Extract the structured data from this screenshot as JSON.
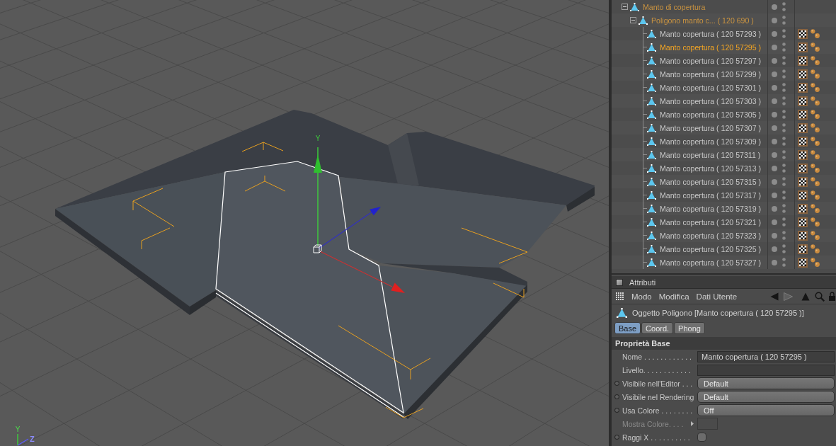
{
  "viewport": {
    "move_gizmo": {
      "y_label": "Y"
    },
    "axis_indicator": {
      "y_label": "Y",
      "z_label": "Z"
    }
  },
  "object_manager": {
    "objects": [
      {
        "name": "Manto di copertura",
        "expanded": true,
        "selected": false,
        "children": [
          {
            "name": "Poligono manto c... ( 120 690 )",
            "expanded": true,
            "selected": false,
            "children": [
              {
                "name": "Manto copertura ( 120 57293 )",
                "selected": false,
                "tags": [
                  {
                    "kind": "texture"
                  },
                  {
                    "kind": "phong"
                  }
                ]
              },
              {
                "name": "Manto copertura ( 120 57295 )",
                "selected": true,
                "tags": [
                  {
                    "kind": "texture"
                  },
                  {
                    "kind": "phong"
                  }
                ]
              },
              {
                "name": "Manto copertura ( 120 57297 )",
                "selected": false,
                "tags": [
                  {
                    "kind": "texture"
                  },
                  {
                    "kind": "phong"
                  }
                ]
              },
              {
                "name": "Manto copertura ( 120 57299 )",
                "selected": false,
                "tags": [
                  {
                    "kind": "texture"
                  },
                  {
                    "kind": "phong"
                  }
                ]
              },
              {
                "name": "Manto copertura ( 120 57301 )",
                "selected": false,
                "tags": [
                  {
                    "kind": "texture"
                  },
                  {
                    "kind": "phong"
                  }
                ]
              },
              {
                "name": "Manto copertura ( 120 57303 )",
                "selected": false,
                "tags": [
                  {
                    "kind": "texture"
                  },
                  {
                    "kind": "phong"
                  }
                ]
              },
              {
                "name": "Manto copertura ( 120 57305 )",
                "selected": false,
                "tags": [
                  {
                    "kind": "texture"
                  },
                  {
                    "kind": "phong"
                  }
                ]
              },
              {
                "name": "Manto copertura ( 120 57307 )",
                "selected": false,
                "tags": [
                  {
                    "kind": "texture"
                  },
                  {
                    "kind": "phong"
                  }
                ]
              },
              {
                "name": "Manto copertura ( 120 57309 )",
                "selected": false,
                "tags": [
                  {
                    "kind": "texture"
                  },
                  {
                    "kind": "phong"
                  }
                ]
              },
              {
                "name": "Manto copertura ( 120 57311 )",
                "selected": false,
                "tags": [
                  {
                    "kind": "texture"
                  },
                  {
                    "kind": "phong"
                  }
                ]
              },
              {
                "name": "Manto copertura ( 120 57313 )",
                "selected": false,
                "tags": [
                  {
                    "kind": "texture"
                  },
                  {
                    "kind": "phong"
                  }
                ]
              },
              {
                "name": "Manto copertura ( 120 57315 )",
                "selected": false,
                "tags": [
                  {
                    "kind": "texture"
                  },
                  {
                    "kind": "phong"
                  }
                ]
              },
              {
                "name": "Manto copertura ( 120 57317 )",
                "selected": false,
                "tags": [
                  {
                    "kind": "texture"
                  },
                  {
                    "kind": "phong"
                  }
                ]
              },
              {
                "name": "Manto copertura ( 120 57319 )",
                "selected": false,
                "tags": [
                  {
                    "kind": "texture"
                  },
                  {
                    "kind": "phong"
                  }
                ]
              },
              {
                "name": "Manto copertura ( 120 57321 )",
                "selected": false,
                "tags": [
                  {
                    "kind": "texture"
                  },
                  {
                    "kind": "phong"
                  }
                ]
              },
              {
                "name": "Manto copertura ( 120 57323 )",
                "selected": false,
                "tags": [
                  {
                    "kind": "texture"
                  },
                  {
                    "kind": "phong"
                  }
                ]
              },
              {
                "name": "Manto copertura ( 120 57325 )",
                "selected": false,
                "tags": [
                  {
                    "kind": "texture"
                  },
                  {
                    "kind": "phong"
                  }
                ]
              },
              {
                "name": "Manto copertura ( 120 57327 )",
                "selected": false,
                "tags": [
                  {
                    "kind": "texture"
                  },
                  {
                    "kind": "phong"
                  }
                ]
              }
            ]
          }
        ]
      }
    ]
  },
  "attributes": {
    "title": "Attributi",
    "menu": [
      "Modo",
      "Modifica",
      "Dati Utente"
    ],
    "nav": [
      {
        "kind": "back",
        "disabled": false
      },
      {
        "kind": "forward",
        "disabled": true
      },
      {
        "kind": "up",
        "disabled": false
      }
    ],
    "object_label": "Oggetto Poligono [Manto copertura ( 120 57295 )]",
    "tabs": [
      {
        "label": "Base",
        "selected": true
      },
      {
        "label": "Coord.",
        "selected": false
      },
      {
        "label": "Phong",
        "selected": false
      }
    ],
    "section": "Proprietà Base",
    "properties": [
      {
        "kind": "text",
        "label": "Nome . . . . . . . . . . . .",
        "value": "Manto copertura ( 120 57295 )",
        "animatable": false,
        "disabled": false
      },
      {
        "kind": "text",
        "label": "Livello. . . . . . . . . . . .",
        "animatable": false,
        "disabled": false
      },
      {
        "kind": "dropdown",
        "label": "Visibile nell'Editor . . .",
        "value": "Default",
        "animatable": true,
        "disabled": false
      },
      {
        "kind": "dropdown",
        "label": "Visibile nel Rendering",
        "value": "Default",
        "animatable": true,
        "disabled": false
      },
      {
        "kind": "dropdown",
        "label": "Usa Colore . . . . . . . .",
        "value": "Off",
        "animatable": true,
        "disabled": false
      },
      {
        "kind": "color",
        "label": "Mostra Colore. . . .",
        "animatable": false,
        "disabled": true
      },
      {
        "kind": "checkbox",
        "label": "Raggi X . . . . . . . . . .",
        "checked": false,
        "animatable": true,
        "disabled": false
      }
    ]
  }
}
